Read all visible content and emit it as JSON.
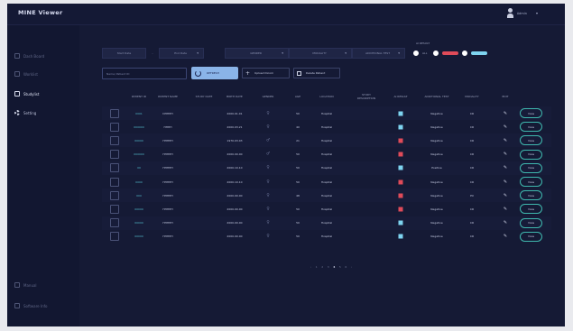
{
  "app": {
    "title": "MINE Viewer"
  },
  "user": {
    "name": "Admin",
    "caret": "▾"
  },
  "sidebar": {
    "items": [
      {
        "label": "Dash Board"
      },
      {
        "label": "Worklist"
      },
      {
        "label": "Studylist"
      },
      {
        "label": "Setting"
      }
    ],
    "bottom": [
      {
        "label": "Manual"
      },
      {
        "label": "Software Info"
      }
    ]
  },
  "filters": {
    "start_date": "Start Date",
    "end_date": "End Date",
    "gender": "GENDER",
    "modality": "MODALITY",
    "additional_test": "ADDITIONAL TEST",
    "ai_result_label": "AI RESULT",
    "ai_all": "ALL",
    "separator": "-",
    "caret": "▾",
    "colors": {
      "red": "#e04b59",
      "blue": "#7ed4f0"
    }
  },
  "search": {
    "placeholder": "Name/ Patient ID"
  },
  "toolbar": {
    "refresh_label": "REFRESH",
    "upload_label": "Upload Dicom",
    "delete_label": "Delete Patient"
  },
  "table": {
    "headers": [
      "PATIENT ID",
      "PATIENT NAME",
      "STUDY DATE",
      "BIRTH DATE",
      "GENDER",
      "AGE",
      "LOCATION",
      "STUDY DESCRIPTION",
      "AI RESULT",
      "ADDITIONAL TEST",
      "MODALITY",
      "EDIT"
    ],
    "view_label": "View",
    "rows": [
      {
        "id": "0001",
        "name": "DHHHH",
        "study": "",
        "birth": "2000.01.01",
        "gender": "♀",
        "age": "50",
        "location": "Hospital",
        "ai": "#7ed4f0",
        "test": "Negative",
        "modality": "CR"
      },
      {
        "id": "000000",
        "name": "HHHH",
        "study": "",
        "birth": "2000.03.21",
        "gender": "♀",
        "age": "40",
        "location": "Hospital",
        "ai": "#7ed4f0",
        "test": "Negative",
        "modality": "CR"
      },
      {
        "id": "00000",
        "name": "HHHHH",
        "study": "",
        "birth": "1970.03.03",
        "gender": "♂",
        "age": "21",
        "location": "Hospital",
        "ai": "#e04b59",
        "test": "Negative",
        "modality": "CR"
      },
      {
        "id": "000000",
        "name": "HHHHH",
        "study": "",
        "birth": "2000.00.00",
        "gender": "♂",
        "age": "50",
        "location": "Hospital",
        "ai": "#e04b59",
        "test": "Negative",
        "modality": "CR"
      },
      {
        "id": "00",
        "name": "HHHHH",
        "study": "",
        "birth": "2000.10.10",
        "gender": "♀",
        "age": "50",
        "location": "Hospital",
        "ai": "#7ed4f0",
        "test": "Positive",
        "modality": "CR"
      },
      {
        "id": "0000",
        "name": "HHHHH",
        "study": "",
        "birth": "2000.10.10",
        "gender": "♀",
        "age": "50",
        "location": "Hospital",
        "ai": "#e04b59",
        "test": "Negative",
        "modality": "CR"
      },
      {
        "id": "000",
        "name": "HHHHH",
        "study": "",
        "birth": "2000.00.00",
        "gender": "♀",
        "age": "48",
        "location": "Hospital",
        "ai": "#e04b59",
        "test": "Negative",
        "modality": "PX"
      },
      {
        "id": "00000",
        "name": "HHHHH",
        "study": "",
        "birth": "2000.00.00",
        "gender": "♀",
        "age": "50",
        "location": "Hospital",
        "ai": "#e04b59",
        "test": "Negative",
        "modality": "CR"
      },
      {
        "id": "00000",
        "name": "HHHHH",
        "study": "",
        "birth": "2000.00.00",
        "gender": "♀",
        "age": "50",
        "location": "Hospital",
        "ai": "#7ed4f0",
        "test": "Negative",
        "modality": "CR"
      },
      {
        "id": "00000",
        "name": "HHHHH",
        "study": "",
        "birth": "2000.00.00",
        "gender": "♀",
        "age": "50",
        "location": "Hospital",
        "ai": "#7ed4f0",
        "test": "Negative",
        "modality": "CR"
      }
    ]
  },
  "pagination": {
    "prev": "‹",
    "pages": [
      "1",
      "2",
      "3",
      "4",
      "5",
      "6"
    ],
    "current": "4",
    "next": "›"
  }
}
